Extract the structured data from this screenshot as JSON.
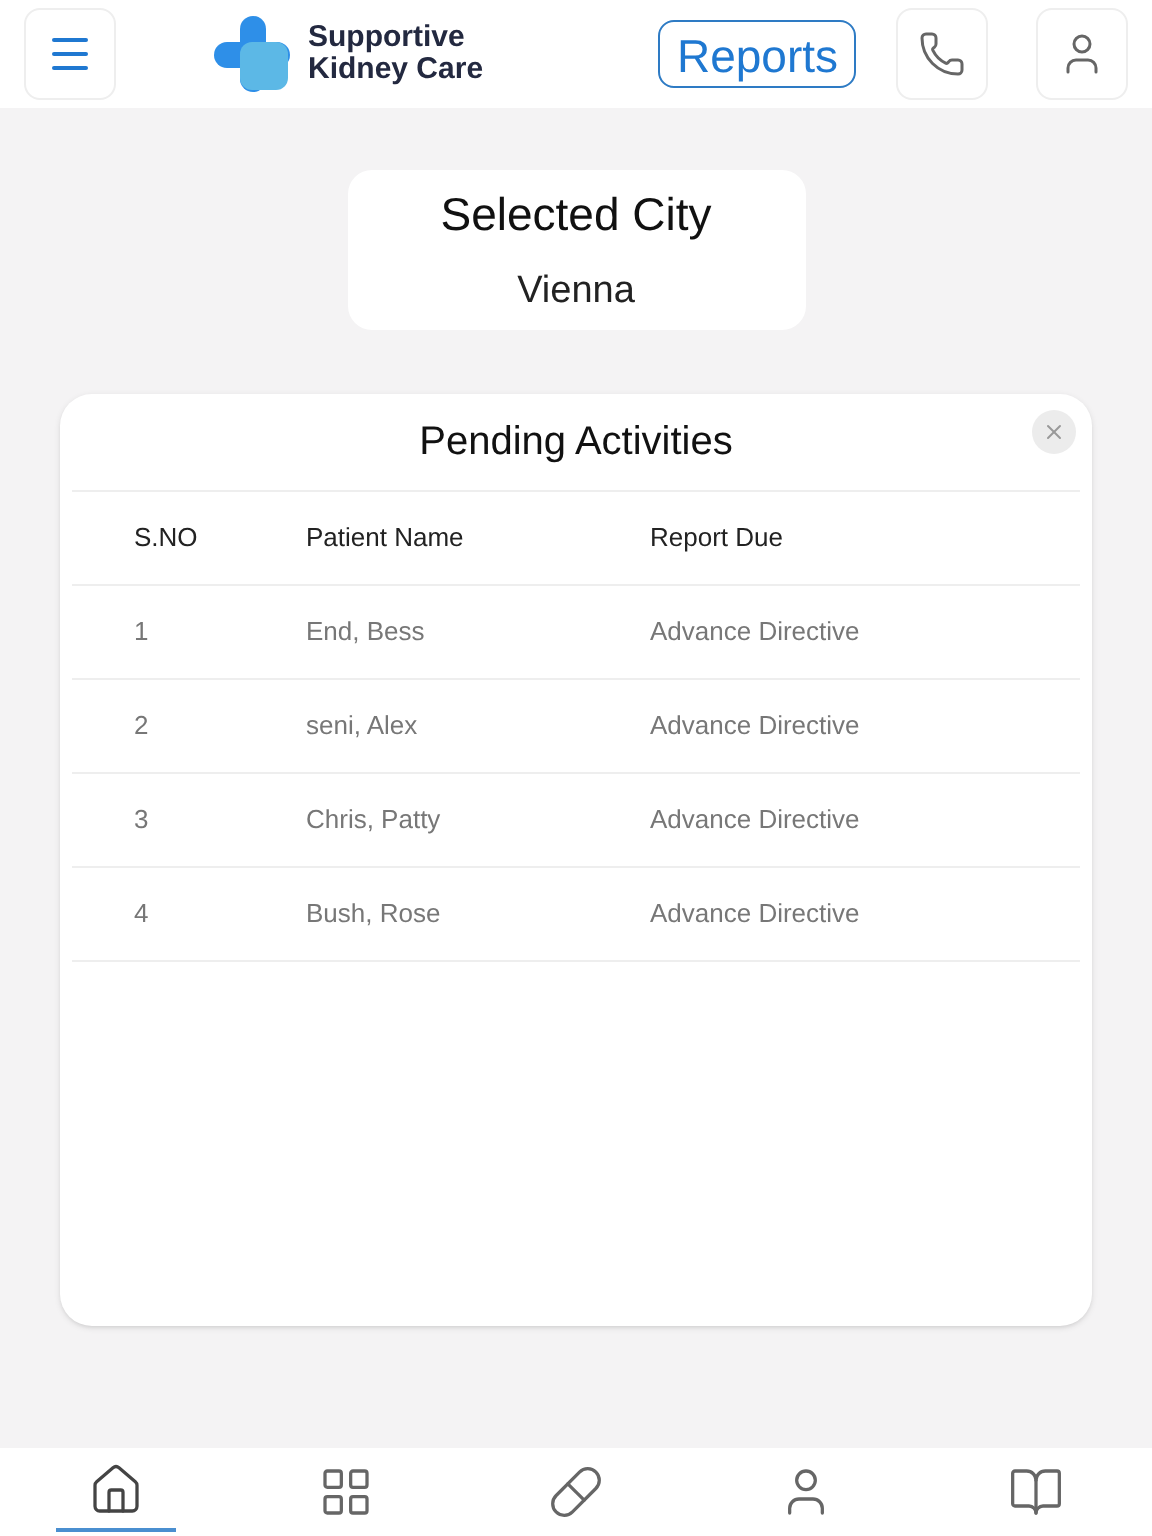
{
  "header": {
    "brand_line_1": "Supportive",
    "brand_line_2": "Kidney Care",
    "reports_button": "Reports"
  },
  "city_card": {
    "title": "Selected City",
    "value": "Vienna"
  },
  "modal": {
    "title": "Pending Activities",
    "table": {
      "columns": [
        "S.NO",
        "Patient Name",
        "Report Due"
      ],
      "rows": [
        {
          "cells": [
            "1",
            "End, Bess",
            "Advance Directive"
          ]
        },
        {
          "cells": [
            "2",
            "seni, Alex",
            "Advance Directive"
          ]
        },
        {
          "cells": [
            "3",
            "Chris, Patty",
            "Advance Directive"
          ]
        },
        {
          "cells": [
            "4",
            "Bush, Rose",
            "Advance Directive"
          ]
        }
      ]
    }
  },
  "bottom_nav": [
    {
      "kind": "home",
      "selected": true
    },
    {
      "kind": "apps",
      "selected": false
    },
    {
      "kind": "pills",
      "selected": false
    },
    {
      "kind": "profile",
      "selected": false
    },
    {
      "kind": "book",
      "selected": false
    }
  ]
}
